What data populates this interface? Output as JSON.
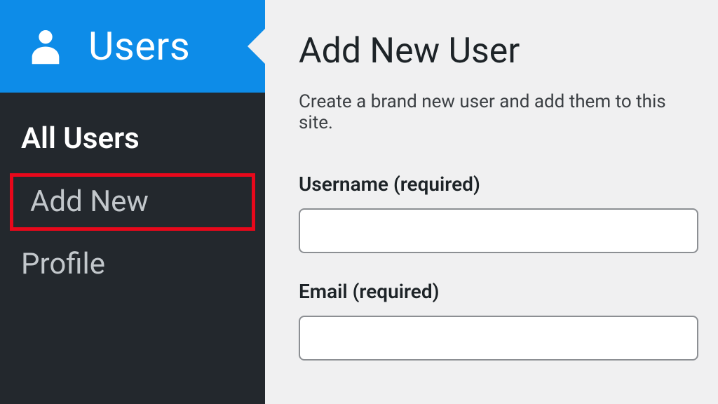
{
  "sidebar": {
    "parent_label": "Users",
    "items": [
      {
        "label": "All Users",
        "active": true
      },
      {
        "label": "Add New",
        "active": false,
        "highlight": true
      },
      {
        "label": "Profile",
        "active": false
      }
    ]
  },
  "main": {
    "title": "Add New User",
    "description": "Create a brand new user and add them to this site.",
    "fields": {
      "username": {
        "label": "Username (required)",
        "value": ""
      },
      "email": {
        "label": "Email (required)",
        "value": ""
      }
    }
  }
}
